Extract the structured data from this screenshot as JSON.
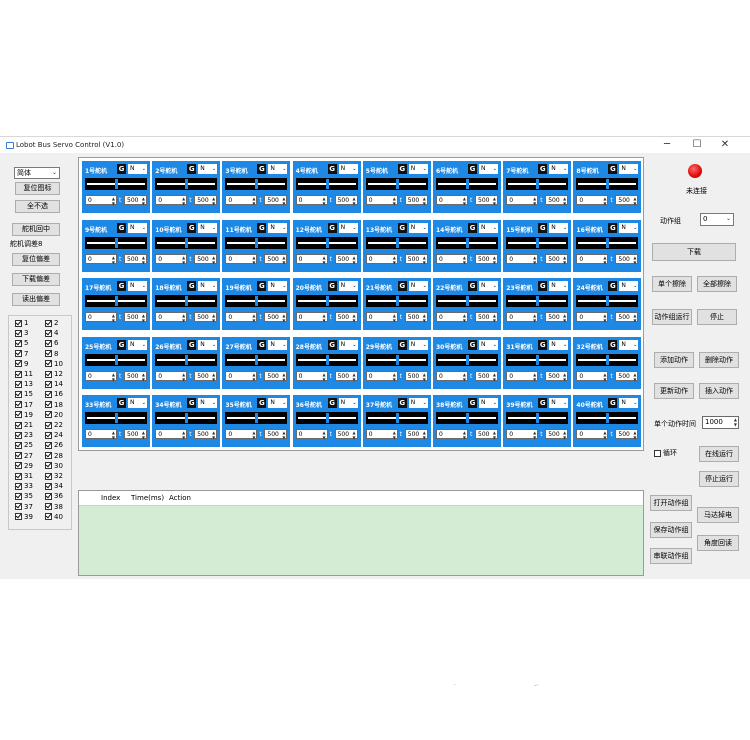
{
  "window": {
    "title": "Lobot Bus Servo Control (V1.0)",
    "minimize": "─",
    "maximize": "☐",
    "close": "✕"
  },
  "left": {
    "language_select": "简体",
    "reset_icon_btn": "复位图标",
    "deselect_all_btn": "全不选",
    "center_servos_btn": "舵机回中",
    "offset_label": "舵机调差8",
    "reset_offset_btn": "复位偏差",
    "download_offset_btn": "下载偏差",
    "read_offset_btn": "读出偏差",
    "checkboxes": [
      "1",
      "2",
      "3",
      "4",
      "5",
      "6",
      "7",
      "8",
      "9",
      "10",
      "11",
      "12",
      "13",
      "14",
      "15",
      "16",
      "17",
      "18",
      "19",
      "20",
      "21",
      "22",
      "23",
      "24",
      "25",
      "26",
      "27",
      "28",
      "29",
      "30",
      "31",
      "32",
      "33",
      "34",
      "35",
      "36",
      "37",
      "38",
      "39",
      "40"
    ]
  },
  "servos": [
    {
      "name": "1号舵机",
      "mode": "N",
      "value": "0",
      "time": "500"
    },
    {
      "name": "2号舵机",
      "mode": "N",
      "value": "0",
      "time": "500"
    },
    {
      "name": "3号舵机",
      "mode": "N",
      "value": "0",
      "time": "500"
    },
    {
      "name": "4号舵机",
      "mode": "N",
      "value": "0",
      "time": "500"
    },
    {
      "name": "5号舵机",
      "mode": "N",
      "value": "0",
      "time": "500"
    },
    {
      "name": "6号舵机",
      "mode": "N",
      "value": "0",
      "time": "500"
    },
    {
      "name": "7号舵机",
      "mode": "N",
      "value": "0",
      "time": "500"
    },
    {
      "name": "8号舵机",
      "mode": "N",
      "value": "0",
      "time": "500"
    },
    {
      "name": "9号舵机",
      "mode": "N",
      "value": "0",
      "time": "500"
    },
    {
      "name": "10号舵机",
      "mode": "N",
      "value": "0",
      "time": "500"
    },
    {
      "name": "11号舵机",
      "mode": "N",
      "value": "0",
      "time": "500"
    },
    {
      "name": "12号舵机",
      "mode": "N",
      "value": "0",
      "time": "500"
    },
    {
      "name": "13号舵机",
      "mode": "N",
      "value": "0",
      "time": "500"
    },
    {
      "name": "14号舵机",
      "mode": "N",
      "value": "0",
      "time": "500"
    },
    {
      "name": "15号舵机",
      "mode": "N",
      "value": "0",
      "time": "500"
    },
    {
      "name": "16号舵机",
      "mode": "N",
      "value": "0",
      "time": "500"
    },
    {
      "name": "17号舵机",
      "mode": "N",
      "value": "0",
      "time": "500"
    },
    {
      "name": "18号舵机",
      "mode": "N",
      "value": "0",
      "time": "500"
    },
    {
      "name": "19号舵机",
      "mode": "N",
      "value": "0",
      "time": "500"
    },
    {
      "name": "20号舵机",
      "mode": "N",
      "value": "0",
      "time": "500"
    },
    {
      "name": "21号舵机",
      "mode": "N",
      "value": "0",
      "time": "500"
    },
    {
      "name": "22号舵机",
      "mode": "N",
      "value": "0",
      "time": "500"
    },
    {
      "name": "23号舵机",
      "mode": "N",
      "value": "0",
      "time": "500"
    },
    {
      "name": "24号舵机",
      "mode": "N",
      "value": "0",
      "time": "500"
    },
    {
      "name": "25号舵机",
      "mode": "N",
      "value": "0",
      "time": "500"
    },
    {
      "name": "26号舵机",
      "mode": "N",
      "value": "0",
      "time": "500"
    },
    {
      "name": "27号舵机",
      "mode": "N",
      "value": "0",
      "time": "500"
    },
    {
      "name": "28号舵机",
      "mode": "N",
      "value": "0",
      "time": "500"
    },
    {
      "name": "29号舵机",
      "mode": "N",
      "value": "0",
      "time": "500"
    },
    {
      "name": "30号舵机",
      "mode": "N",
      "value": "0",
      "time": "500"
    },
    {
      "name": "31号舵机",
      "mode": "N",
      "value": "0",
      "time": "500"
    },
    {
      "name": "32号舵机",
      "mode": "N",
      "value": "0",
      "time": "500"
    },
    {
      "name": "33号舵机",
      "mode": "N",
      "value": "0",
      "time": "500"
    },
    {
      "name": "34号舵机",
      "mode": "N",
      "value": "0",
      "time": "500"
    },
    {
      "name": "35号舵机",
      "mode": "N",
      "value": "0",
      "time": "500"
    },
    {
      "name": "36号舵机",
      "mode": "N",
      "value": "0",
      "time": "500"
    },
    {
      "name": "37号舵机",
      "mode": "N",
      "value": "0",
      "time": "500"
    },
    {
      "name": "38号舵机",
      "mode": "N",
      "value": "0",
      "time": "500"
    },
    {
      "name": "39号舵机",
      "mode": "N",
      "value": "0",
      "time": "500"
    },
    {
      "name": "40号舵机",
      "mode": "N",
      "value": "0",
      "time": "500"
    }
  ],
  "servo_labels": {
    "g_button": "G",
    "time_prefix": "t"
  },
  "right": {
    "status": "未连接",
    "action_group_label": "动作组",
    "action_group_value": "0",
    "download_btn": "下载",
    "erase_single_btn": "单个擦除",
    "erase_all_btn": "全部擦除",
    "run_group_btn": "动作组运行",
    "stop_btn": "停止",
    "add_action_btn": "添加动作",
    "delete_action_btn": "删除动作",
    "update_action_btn": "更新动作",
    "insert_action_btn": "插入动作",
    "single_time_label": "单个动作时间",
    "single_time_value": "1000",
    "loop_label": "循环",
    "online_run_btn": "在线运行",
    "stop_run_btn": "停止运行",
    "open_group_btn": "打开动作组",
    "motor_btn": "马达掉电",
    "save_group_btn": "保存动作组",
    "read_angle_btn": "角度回读",
    "chain_group_btn": "串联动作组"
  },
  "table": {
    "columns": [
      "Index",
      "Time(ms)",
      "Action"
    ]
  },
  "colors": {
    "servo_panel": "#1e88e5",
    "status_lamp": "#e01010",
    "table_body": "#d4ecd4"
  }
}
